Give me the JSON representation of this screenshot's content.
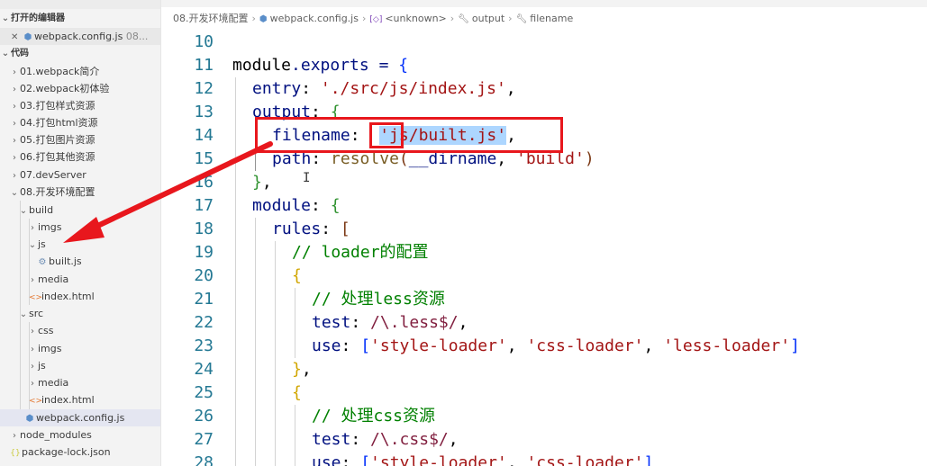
{
  "explorer": {
    "open_editors_title": "打开的编辑器",
    "open_editor_file": "webpack.config.js",
    "open_editor_path": "08...",
    "folder_title": "代码",
    "items": [
      {
        "label": "01.webpack简介"
      },
      {
        "label": "02.webpack初体验"
      },
      {
        "label": "03.打包样式资源"
      },
      {
        "label": "04.打包html资源"
      },
      {
        "label": "05.打包图片资源"
      },
      {
        "label": "06.打包其他资源"
      },
      {
        "label": "07.devServer"
      },
      {
        "label": "08.开发环境配置"
      },
      {
        "label": "build"
      },
      {
        "label": "imgs"
      },
      {
        "label": "js"
      },
      {
        "label": "built.js"
      },
      {
        "label": "media"
      },
      {
        "label": "index.html"
      },
      {
        "label": "src"
      },
      {
        "label": "css"
      },
      {
        "label": "imgs"
      },
      {
        "label": "js"
      },
      {
        "label": "media"
      },
      {
        "label": "index.html"
      },
      {
        "label": "webpack.config.js"
      },
      {
        "label": "node_modules"
      },
      {
        "label": "package-lock.json"
      }
    ]
  },
  "breadcrumb": {
    "folder": "08.开发环境配置",
    "file": "webpack.config.js",
    "symbol1": "<unknown>",
    "symbol2": "output",
    "symbol3": "filename"
  },
  "code": {
    "line_numbers": [
      "10",
      "11",
      "12",
      "13",
      "14",
      "15",
      "16",
      "17",
      "18",
      "19",
      "20",
      "21",
      "22",
      "23",
      "24",
      "25",
      "26",
      "27",
      "28"
    ],
    "l11_module": "module",
    "l11_exports": ".exports = ",
    "l11_brace": "{",
    "l12_key": "entry",
    "l12_colon": ": ",
    "l12_str": "'./src/js/index.js'",
    "l12_comma": ",",
    "l13_key": "output",
    "l13_colon": ": ",
    "l13_brace": "{",
    "l14_key": "filename",
    "l14_colon": ":  ",
    "l14_str_a": "'js/",
    "l14_str_b": "built.js'",
    "l14_comma": ",",
    "l15_key": "path",
    "l15_colon": ": ",
    "l15_fn": "resolve",
    "l15_paren_open": "(",
    "l15_arg": "__dirname",
    "l15_sep": ", ",
    "l15_str": "'build'",
    "l15_paren_close": ")",
    "l16_close": "}",
    "l16_comma": ",",
    "l17_key": "module",
    "l17_colon": ": ",
    "l17_brace": "{",
    "l18_key": "rules",
    "l18_colon": ": ",
    "l18_bracket": "[",
    "l19_comment": "// loader的配置",
    "l20_brace": "{",
    "l21_comment": "// 处理less资源",
    "l22_key": "test",
    "l22_colon": ": ",
    "l22_re": "/\\.less$/",
    "l22_comma": ",",
    "l23_key": "use",
    "l23_colon": ": ",
    "l23_open": "[",
    "l23_s1": "'style-loader'",
    "l23_c1": ", ",
    "l23_s2": "'css-loader'",
    "l23_c2": ", ",
    "l23_s3": "'less-loader'",
    "l23_close": "]",
    "l24_close": "}",
    "l24_comma": ",",
    "l25_brace": "{",
    "l26_comment": "// 处理css资源",
    "l27_key": "test",
    "l27_colon": ": ",
    "l27_re": "/\\.css$/",
    "l27_comma": ",",
    "l28_key": "use",
    "l28_colon": ": ",
    "l28_open": "[",
    "l28_s1": "'style-loader'",
    "l28_c1": ", ",
    "l28_s2": "'css-loader'",
    "l28_close": "]"
  },
  "colors": {
    "annotation_red": "#e8171d",
    "selection": "#add6ff",
    "line_number": "#237893"
  }
}
